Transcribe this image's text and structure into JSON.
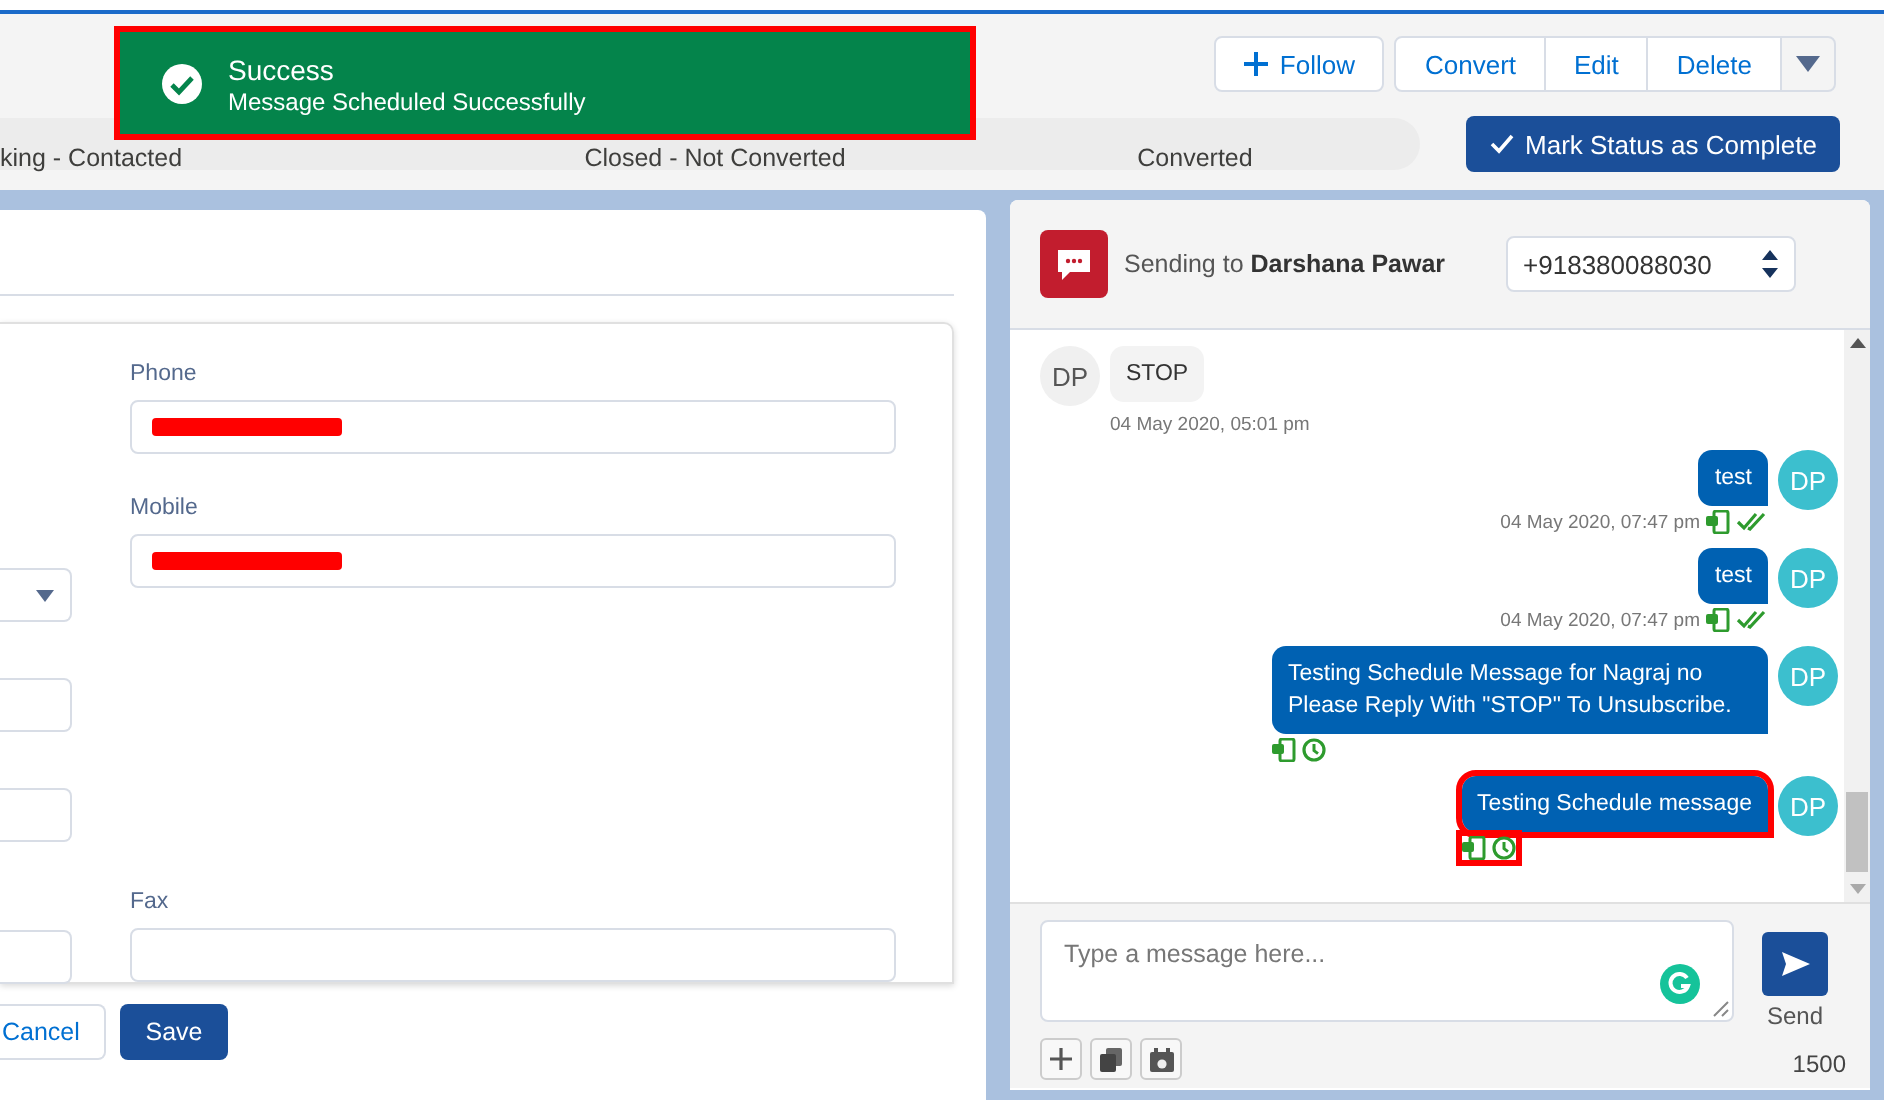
{
  "toast": {
    "title": "Success",
    "message": "Message Scheduled Successfully",
    "highlighted": true
  },
  "actions": [
    {
      "kind": "follow",
      "label": "Follow"
    },
    {
      "kind": "plain",
      "label": "Convert"
    },
    {
      "kind": "plain",
      "label": "Edit"
    },
    {
      "kind": "plain",
      "label": "Delete"
    },
    {
      "kind": "menu"
    }
  ],
  "path": {
    "stages": [
      {
        "label": "king - Contacted"
      },
      {
        "label": "Closed - Not Converted"
      },
      {
        "label": "Converted"
      }
    ],
    "complete_button": "Mark Status as Complete"
  },
  "form": {
    "left_fields": [
      {
        "kind": "dropdown"
      },
      {
        "kind": "text"
      },
      {
        "kind": "text"
      },
      {
        "kind": "text"
      }
    ],
    "right_fields": [
      {
        "label": "Phone",
        "redacted": true
      },
      {
        "label": "Mobile",
        "redacted": true
      },
      {
        "label": "Fax",
        "redacted": false
      }
    ],
    "cancel": "Cancel",
    "save": "Save"
  },
  "chat": {
    "header": "Sending to **Darshana Pawar**",
    "phone": "+918380088030",
    "messages": [
      {
        "kind": "received",
        "avatar": "DP",
        "text": "STOP",
        "time": "04 May 2020, 05:01 pm",
        "highlighted": false
      },
      {
        "kind": "delivered",
        "avatar": "DP",
        "text": "test",
        "time": "04 May 2020, 07:47 pm",
        "highlighted": false
      },
      {
        "kind": "delivered",
        "avatar": "DP",
        "text": "test",
        "time": "04 May 2020, 07:47 pm",
        "highlighted": false
      },
      {
        "kind": "scheduled",
        "avatar": "DP",
        "text": "Testing Schedule Message for Nagraj no Please Reply With \"STOP\" To Unsubscribe.",
        "highlighted": false
      },
      {
        "kind": "scheduled",
        "avatar": "DP",
        "text": "Testing Schedule message",
        "highlighted": true
      }
    ],
    "composer": {
      "placeholder": "Type a message here...",
      "send": "Send",
      "counter": "1500"
    }
  }
}
